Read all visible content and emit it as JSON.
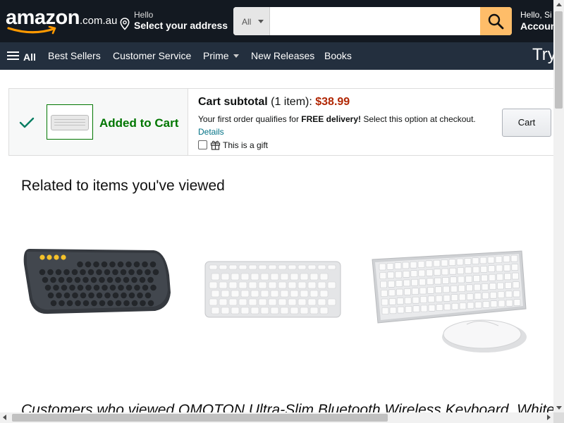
{
  "header": {
    "logo_word": "amazon",
    "logo_tld": ".com.au",
    "location_line1": "Hello",
    "location_line2": "Select your address",
    "search_category": "All",
    "search_value": "",
    "account_line1": "Hello, Si",
    "account_line2": "Accoun"
  },
  "nav": {
    "all_label": "All",
    "items": [
      "Best Sellers",
      "Customer Service",
      "Prime",
      "New Releases",
      "Books"
    ],
    "promo": "Try"
  },
  "cart": {
    "added_label": "Added to Cart",
    "subtotal_label": "Cart subtotal",
    "item_count": "(1 item):",
    "price": "$38.99",
    "qualify_prefix": "Your first order qualifies for ",
    "qualify_bold": "FREE delivery!",
    "qualify_suffix": " Select this option at checkout.",
    "details_link": "Details",
    "gift_label": "This is a gift",
    "cart_button": "Cart"
  },
  "related": {
    "heading": "Related to items you've viewed"
  },
  "customers_viewed": {
    "prefix": "Customers who viewed ",
    "product": "OMOTON Ultra-Slim Bluetooth Wireless Keyboard, White"
  },
  "colors": {
    "header_bg": "#131921",
    "nav_bg": "#232f3e",
    "search_button": "#febd69",
    "price": "#b12704",
    "added_green": "#007600",
    "link": "#007185"
  }
}
